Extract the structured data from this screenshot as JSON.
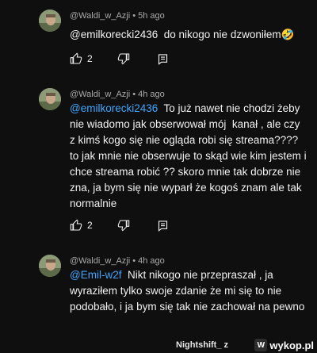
{
  "comments": [
    {
      "author": "@Waldi_w_Azji",
      "age": "5h ago",
      "mention": "@emilkorecki2436",
      "text": "  do nikogo nie dzwoniłem🤣",
      "likes": "2"
    },
    {
      "author": "@Waldi_w_Azji",
      "age": "4h ago",
      "mention": "@emilkorecki2436",
      "text": "  To już nawet nie chodzi żeby nie wiadomo jak obserwował mój  kanał , ale czy z kimś kogo się nie ogląda robi się streama???? to jak mnie nie obserwuje to skąd wie kim jestem i chce streama robić ?? skoro mnie tak dobrze nie zna, ja bym się nie wyparł że kogoś znam ale tak normalnie",
      "likes": "2"
    },
    {
      "author": "@Waldi_w_Azji",
      "age": "4h ago",
      "mention": "@Emil-w2f",
      "text": "  Nikt nikogo nie przepraszał , ja wyraziłem tylko swoje zdanie że mi się to nie podobało, i ja bym się tak nie zachował na pewno"
    }
  ],
  "separator": " • ",
  "footer": {
    "username": "Nightshift_  z",
    "logo_text": "wykop.pl"
  },
  "colors": {
    "background": "#0f0f0f",
    "text": "#f1f1f1",
    "meta": "#aaaaaa",
    "mention_plain": "#f1f1f1",
    "mention_link": "#3ea6ff"
  }
}
